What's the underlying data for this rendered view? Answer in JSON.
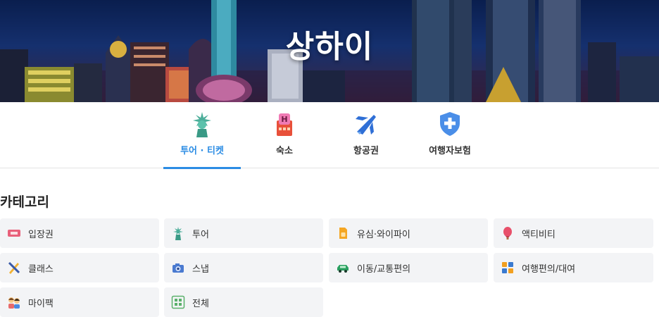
{
  "hero": {
    "title": "상하이"
  },
  "tabs": [
    {
      "label": "투어 · 티켓",
      "icon": "statue-of-liberty-icon",
      "active": true
    },
    {
      "label": "숙소",
      "icon": "hotel-icon",
      "active": false
    },
    {
      "label": "항공권",
      "icon": "airplane-icon",
      "active": false
    },
    {
      "label": "여행자보험",
      "icon": "insurance-shield-icon",
      "active": false
    }
  ],
  "categories": {
    "title": "카테고리",
    "items": [
      {
        "label": "입장권",
        "icon": "ticket-icon"
      },
      {
        "label": "투어",
        "icon": "statue-of-liberty-icon"
      },
      {
        "label": "유심·와이파이",
        "icon": "sim-card-icon"
      },
      {
        "label": "액티비티",
        "icon": "hot-air-balloon-icon"
      },
      {
        "label": "클래스",
        "icon": "craft-tools-icon"
      },
      {
        "label": "스냅",
        "icon": "camera-icon"
      },
      {
        "label": "이동/교통편의",
        "icon": "car-icon"
      },
      {
        "label": "여행편의/대여",
        "icon": "convenience-keys-icon"
      },
      {
        "label": "마이팩",
        "icon": "family-icon"
      },
      {
        "label": "전체",
        "icon": "grid-icon"
      }
    ]
  },
  "colors": {
    "accent": "#2b8ce4",
    "tile_bg": "#f3f4f6",
    "divider": "#e3e3e3"
  }
}
